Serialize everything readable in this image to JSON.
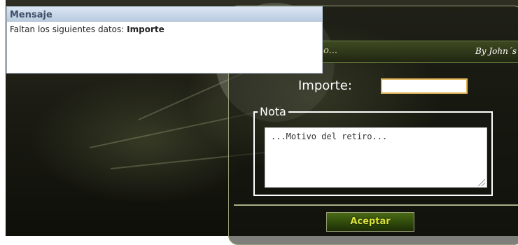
{
  "dialog": {
    "title": "Mensaje",
    "message": "Faltan los siguientes datos:",
    "missing_field": "Importe"
  },
  "panel": {
    "title_fragment": "o...",
    "author": "By John´s",
    "amount_label": "Importe:",
    "amount_value": "",
    "note_legend": "Nota",
    "note_placeholder": "...Motivo del retiro...",
    "accept_label": "Aceptar"
  },
  "colors": {
    "dialog_title_text": "#3f4f67",
    "input_border": "#e3b85a",
    "button_text": "#d9e13a",
    "panel_header": "#2f3a18"
  }
}
